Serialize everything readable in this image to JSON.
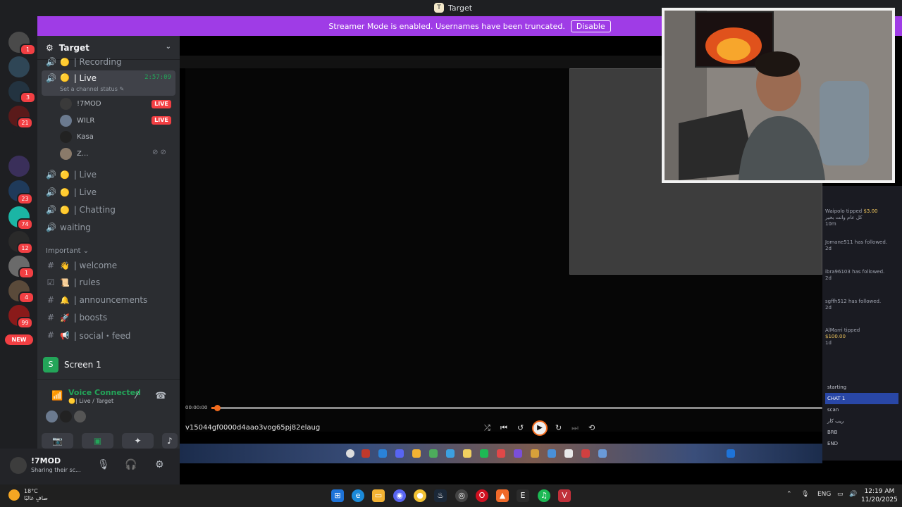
{
  "window": {
    "title": "Target"
  },
  "banner": {
    "text": "Streamer Mode is enabled. Usernames have been truncated.",
    "button": "Disable"
  },
  "rail": {
    "badges": [
      "1",
      "3",
      "21",
      "23",
      "74",
      "12",
      "1",
      "4",
      "99"
    ],
    "new_label": "NEW"
  },
  "server": {
    "name": "Target"
  },
  "channels": {
    "recording": "| Recording",
    "live_active": "| Live",
    "live_active_timer": "2:57:09",
    "live_active_status": "Set a channel status",
    "members": [
      {
        "name": "!7MOD",
        "live": "LIVE"
      },
      {
        "name": "WILR",
        "live": "LIVE"
      },
      {
        "name": "Kasa"
      },
      {
        "name": "Z..."
      }
    ],
    "live2": "| Live",
    "live3": "| Live",
    "chatting": "| Chatting",
    "waiting": "waiting",
    "category": "Important",
    "welcome": "| welcome",
    "rules": "| rules",
    "announcements": "| announcements",
    "boosts": "| boosts",
    "social": "| social・feed"
  },
  "stream_panel": {
    "label": "Screen 1"
  },
  "voice": {
    "status": "Voice Connected",
    "channel": "| Live / Target"
  },
  "user": {
    "name": "!7MOD",
    "status": "Sharing their sc..."
  },
  "player": {
    "time": "00:00:00",
    "file_name": "v15044gf0000d4aao3vog65pj82elaug",
    "progress": 0.005
  },
  "chat": {
    "alerts": [
      {
        "user": "Waipolo",
        "text": "tipped",
        "amount": "$3.00",
        "note": "كل عام وانت بخير",
        "time": "10m"
      },
      {
        "user": "Jomane511",
        "text": "has followed.",
        "time": "2d"
      },
      {
        "user": "ibra96103",
        "text": "has followed.",
        "time": "2d"
      },
      {
        "user": "sgffh512",
        "text": "has followed.",
        "time": "2d"
      },
      {
        "user": "AlMarri",
        "text": "tipped",
        "amount": "$100.00",
        "time": "1d"
      }
    ],
    "menu": [
      "starting",
      "CHAT 1",
      "scan",
      "ريب كار",
      "BRB",
      "END"
    ],
    "menu_selected": "CHAT 1"
  },
  "taskbar": {
    "weather_temp": "18°C",
    "weather_desc": "صافٍ غالبًا",
    "lang": "ENG",
    "time": "12:19 AM",
    "date": "11/20/2025"
  }
}
